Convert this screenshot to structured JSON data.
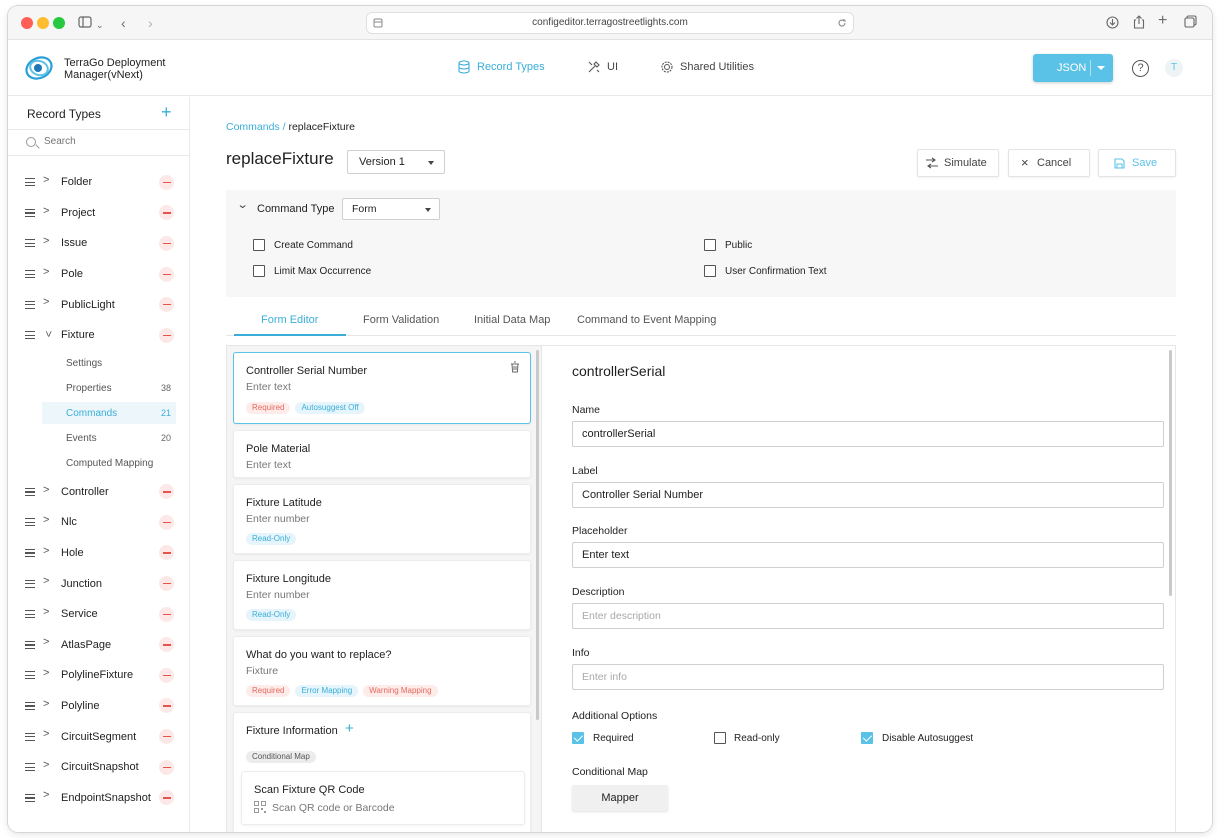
{
  "browser": {
    "url": "configeditor.terragostreetlights.com"
  },
  "header": {
    "brand": "TerraGo Deployment Manager(vNext)",
    "nav": [
      {
        "label": "Record Types",
        "icon": "database-icon",
        "active": true
      },
      {
        "label": "UI",
        "icon": "tools-icon",
        "active": false
      },
      {
        "label": "Shared Utilities",
        "icon": "gear-code-icon",
        "active": false
      }
    ],
    "json_button": "JSON",
    "help": "?",
    "avatar": "T",
    "accent": "#5bc2e7"
  },
  "sidebar": {
    "title": "Record Types",
    "search_placeholder": "Search",
    "items_top": [
      {
        "label": "Folder"
      },
      {
        "label": "Project"
      },
      {
        "label": "Issue"
      },
      {
        "label": "Pole"
      },
      {
        "label": "PublicLight"
      }
    ],
    "expanded": {
      "label": "Fixture",
      "children": [
        {
          "label": "Settings",
          "count": ""
        },
        {
          "label": "Properties",
          "count": "38"
        },
        {
          "label": "Commands",
          "count": "21",
          "active": true
        },
        {
          "label": "Events",
          "count": "20"
        },
        {
          "label": "Computed Mapping",
          "count": ""
        }
      ]
    },
    "items_bottom": [
      {
        "label": "Controller"
      },
      {
        "label": "Nlc"
      },
      {
        "label": "Hole"
      },
      {
        "label": "Junction"
      },
      {
        "label": "Service"
      },
      {
        "label": "AtlasPage"
      },
      {
        "label": "PolylineFixture"
      },
      {
        "label": "Polyline"
      },
      {
        "label": "CircuitSegment"
      },
      {
        "label": "CircuitSnapshot"
      },
      {
        "label": "EndpointSnapshot"
      }
    ]
  },
  "main": {
    "breadcrumb": {
      "parent": "Commands",
      "sep": " / ",
      "current": "replaceFixture"
    },
    "title": "replaceFixture",
    "version": "Version 1",
    "actions": {
      "simulate": "Simulate",
      "cancel": "Cancel",
      "save": "Save"
    },
    "command_type": {
      "label": "Command Type",
      "value": "Form",
      "options": [
        {
          "label": "Create Command",
          "checked": false
        },
        {
          "label": "Public",
          "checked": false
        },
        {
          "label": "Limit Max Occurrence",
          "checked": false
        },
        {
          "label": "User Confirmation Text",
          "checked": false
        }
      ]
    },
    "tabs": [
      "Form Editor",
      "Form Validation",
      "Initial Data Map",
      "Command to Event Mapping"
    ],
    "fields": [
      {
        "title": "Controller Serial Number",
        "sub": "Enter text",
        "tags": [
          "Required",
          "Autosuggest Off"
        ]
      },
      {
        "title": "Pole Material",
        "sub": "Enter text",
        "tags": []
      },
      {
        "title": "Fixture Latitude",
        "sub": "Enter number",
        "tags": [
          "Read-Only"
        ]
      },
      {
        "title": "Fixture Longitude",
        "sub": "Enter number",
        "tags": [
          "Read-Only"
        ]
      },
      {
        "title": "What do you want to replace?",
        "sub": "Fixture",
        "tags": [
          "Required",
          "Error Mapping",
          "Warning Mapping"
        ]
      },
      {
        "title": "Fixture Information",
        "sub": "",
        "tags": [
          "Conditional Map"
        ]
      },
      {
        "title": "Scan Fixture QR Code",
        "sub": "Scan QR code or Barcode",
        "tags": []
      }
    ],
    "editor": {
      "title": "controllerSerial",
      "name_label": "Name",
      "name_value": "controllerSerial",
      "label_label": "Label",
      "label_value": "Controller Serial Number",
      "placeholder_label": "Placeholder",
      "placeholder_value": "Enter text",
      "description_label": "Description",
      "description_placeholder": "Enter description",
      "info_label": "Info",
      "info_placeholder": "Enter info",
      "additional_label": "Additional Options",
      "opt_required": "Required",
      "opt_readonly": "Read-only",
      "opt_autosuggest": "Disable Autosuggest",
      "conditional_label": "Conditional Map",
      "mapper_button": "Mapper"
    }
  }
}
